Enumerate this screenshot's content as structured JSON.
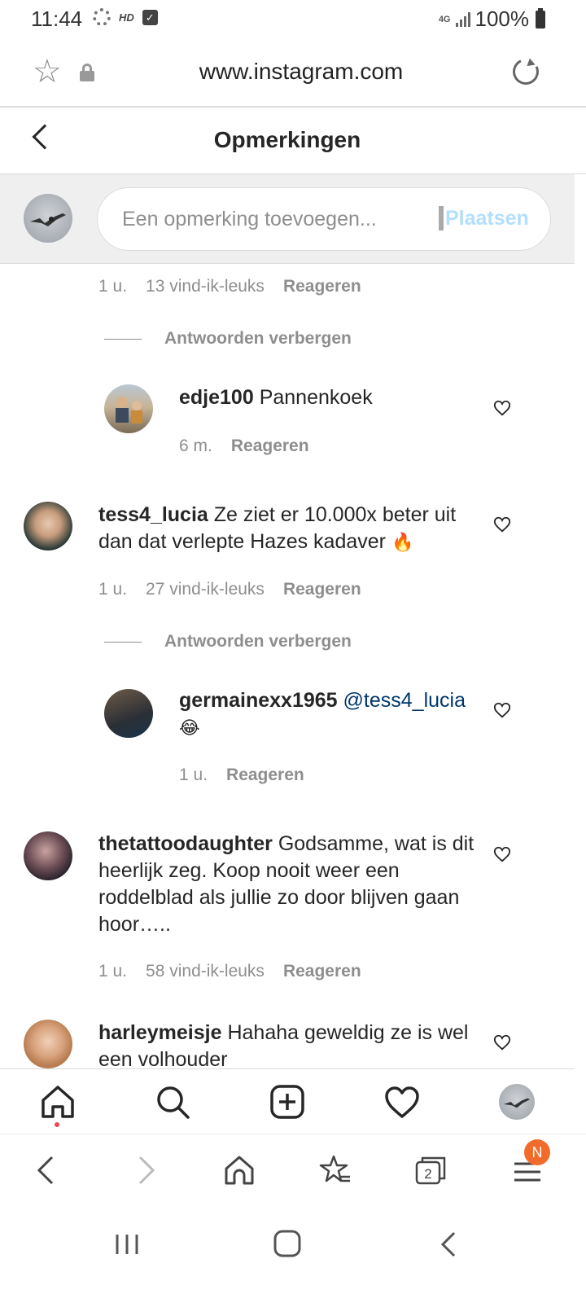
{
  "status_bar": {
    "time": "11:44",
    "hd_label": "HD",
    "network": "4G",
    "battery": "100%"
  },
  "url_bar": {
    "url": "www.instagram.com"
  },
  "header": {
    "title": "Opmerkingen"
  },
  "comment_input": {
    "placeholder": "Een opmerking toevoegen...",
    "post_label": "Plaatsen"
  },
  "comments": {
    "top_meta": {
      "time": "1 u.",
      "likes": "13 vind-ik-leuks",
      "reply": "Reageren"
    },
    "hide_replies_1": "Antwoorden verbergen",
    "reply_1": {
      "user": "edje100",
      "text": "Pannenkoek",
      "time": "6 m.",
      "reply": "Reageren"
    },
    "comment_2": {
      "user": "tess4_lucia",
      "text": "Ze ziet er 10.000x beter uit dan dat verlepte Hazes kadaver",
      "emoji": "🔥",
      "time": "1 u.",
      "likes": "27 vind-ik-leuks",
      "reply": "Reageren"
    },
    "hide_replies_2": "Antwoorden verbergen",
    "reply_2": {
      "user": "germainexx1965",
      "mention": "@tess4_lucia",
      "emoji": "😂",
      "time": "1 u.",
      "reply": "Reageren"
    },
    "comment_3": {
      "user": "thetattoodaughter",
      "text": "Godsamme, wat is dit heerlijk zeg. Koop nooit weer een roddelblad als jullie zo door blijven gaan hoor…..",
      "time": "1 u.",
      "likes": "58 vind-ik-leuks",
      "reply": "Reageren"
    },
    "comment_4": {
      "user": "harleymeisje",
      "text": "Hahaha geweldig ze is wel een volhouder"
    }
  },
  "ig_nav": {
    "items": [
      "home-icon",
      "search-icon",
      "new-post-icon",
      "activity-icon",
      "profile-avatar"
    ]
  },
  "browser_nav": {
    "tabs_count": "2",
    "menu_badge": "N"
  },
  "colors": {
    "link_blue": "#b2dffc",
    "mention_blue": "#00376b",
    "secondary_text": "#8e8e8e",
    "badge_orange": "#f26b2a"
  }
}
